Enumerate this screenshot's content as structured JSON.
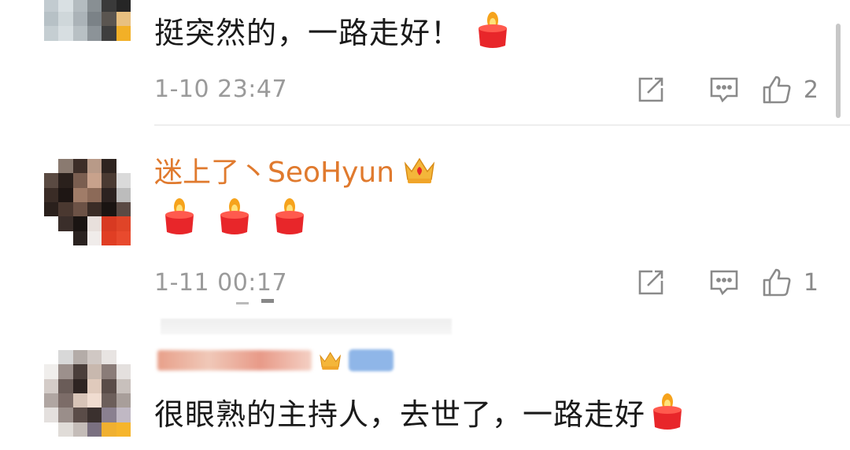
{
  "comments": [
    {
      "username": "",
      "text": "挺突然的，一路走好！",
      "emoji_count": 1,
      "timestamp": "1-10 23:47",
      "likes": "2"
    },
    {
      "username": "迷上了丶SeoHyun",
      "text": "",
      "emoji_count": 3,
      "timestamp": "1-11 00:17",
      "likes": "1"
    },
    {
      "username": "",
      "text": "很眼熟的主持人，去世了，一路走好",
      "emoji_count": 1
    }
  ],
  "icons": {
    "forward": "share-icon",
    "comment": "comment-icon",
    "like": "thumbs-up-icon",
    "candle": "candle-emoji-icon",
    "crown": "crown-icon"
  },
  "colors": {
    "username": "#e07a2e",
    "meta": "#9a9a9a",
    "text": "#1a1a1a",
    "candle_red": "#e8262a",
    "flame": "#f6a31c"
  }
}
